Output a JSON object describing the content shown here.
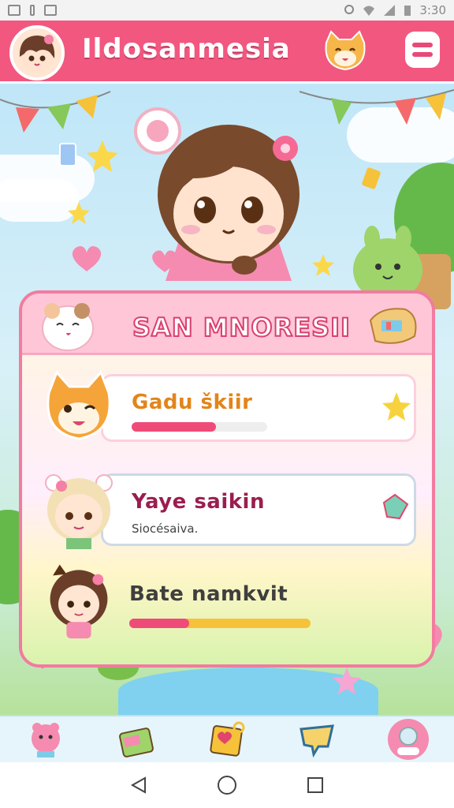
{
  "status_bar": {
    "time": "3:30"
  },
  "header": {
    "title": "Ildosanmesia"
  },
  "panel": {
    "title": "SAN MNORESII"
  },
  "cards": [
    {
      "title": "Gadu škiir",
      "subtitle": "",
      "progress": 0.62,
      "title_color": "#e2851a"
    },
    {
      "title": "Yaye saikin",
      "subtitle": "Siocésaiva.",
      "progress": null,
      "title_color": "#9b1d50"
    },
    {
      "title": "Bate namkvit",
      "subtitle": "",
      "progress": 0.33,
      "title_color": "#3f3f3f"
    }
  ],
  "colors": {
    "header": "#f2577f",
    "accent": "#e74a78",
    "bar_pink": "#ef4b78",
    "bar_yellow": "#f6c23a"
  },
  "icons": {
    "header_avatar": "girl-avatar-icon",
    "header_pet": "cat-face-icon",
    "menu": "menu-icon",
    "nav": [
      "pink-pet-icon",
      "gift-box-icon",
      "map-card-icon",
      "chat-bubble-icon",
      "profile-icon"
    ]
  }
}
